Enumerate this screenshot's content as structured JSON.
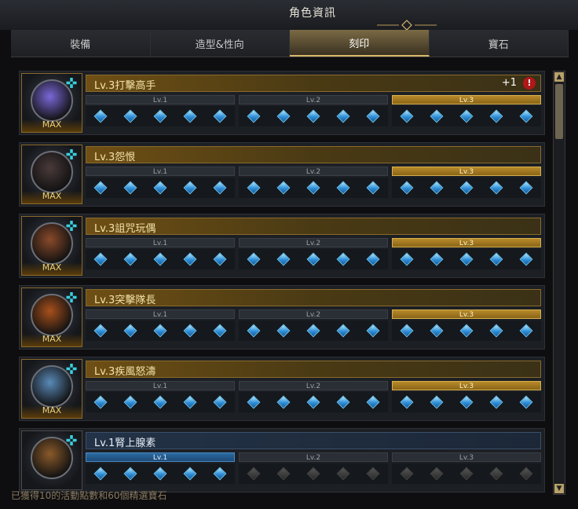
{
  "window": {
    "title": "角色資訊"
  },
  "tabs": [
    {
      "label": "裝備",
      "active": false
    },
    {
      "label": "造型&性向",
      "active": false
    },
    {
      "label": "刻印",
      "active": true
    },
    {
      "label": "寶石",
      "active": false
    }
  ],
  "engravings": [
    {
      "name": "Lv.3打擊高手",
      "max": true,
      "max_label": "MAX",
      "bonus": "+1",
      "warning": "!",
      "style": "gold",
      "orb_color": "#7a68d8",
      "levels": [
        {
          "label": "Lv.1",
          "state": "dim"
        },
        {
          "label": "Lv.2",
          "state": "dim"
        },
        {
          "label": "Lv.3",
          "state": "gold"
        }
      ],
      "gems_filled": 15
    },
    {
      "name": "Lv.3怨恨",
      "max": true,
      "max_label": "MAX",
      "style": "gold",
      "orb_color": "#4a3a3a",
      "levels": [
        {
          "label": "Lv.1",
          "state": "dim"
        },
        {
          "label": "Lv.2",
          "state": "dim"
        },
        {
          "label": "Lv.3",
          "state": "gold"
        }
      ],
      "gems_filled": 15
    },
    {
      "name": "Lv.3詛咒玩偶",
      "max": true,
      "max_label": "MAX",
      "style": "gold",
      "orb_color": "#8a4a2a",
      "levels": [
        {
          "label": "Lv.1",
          "state": "dim"
        },
        {
          "label": "Lv.2",
          "state": "dim"
        },
        {
          "label": "Lv.3",
          "state": "gold"
        }
      ],
      "gems_filled": 15
    },
    {
      "name": "Lv.3突擊隊長",
      "max": true,
      "max_label": "MAX",
      "style": "gold",
      "orb_color": "#a8501c",
      "levels": [
        {
          "label": "Lv.1",
          "state": "dim"
        },
        {
          "label": "Lv.2",
          "state": "dim"
        },
        {
          "label": "Lv.3",
          "state": "gold"
        }
      ],
      "gems_filled": 15
    },
    {
      "name": "Lv.3疾風怒濤",
      "max": true,
      "max_label": "MAX",
      "style": "gold",
      "orb_color": "#5a8ab8",
      "levels": [
        {
          "label": "Lv.1",
          "state": "dim"
        },
        {
          "label": "Lv.2",
          "state": "dim"
        },
        {
          "label": "Lv.3",
          "state": "gold"
        }
      ],
      "gems_filled": 15
    },
    {
      "name": "Lv.1腎上腺素",
      "max": false,
      "max_label": "",
      "style": "blue",
      "orb_color": "#8a5a2a",
      "levels": [
        {
          "label": "Lv.1",
          "state": "blue"
        },
        {
          "label": "Lv.2",
          "state": "dim"
        },
        {
          "label": "Lv.3",
          "state": "dim"
        }
      ],
      "gems_filled": 5
    }
  ],
  "footer": {
    "text": "已獲得10的活動點數和60個精選寶石"
  },
  "icons": {
    "plus": "compass-plus-icon",
    "warning": "warning-icon",
    "gem": "diamond-gem-icon"
  }
}
